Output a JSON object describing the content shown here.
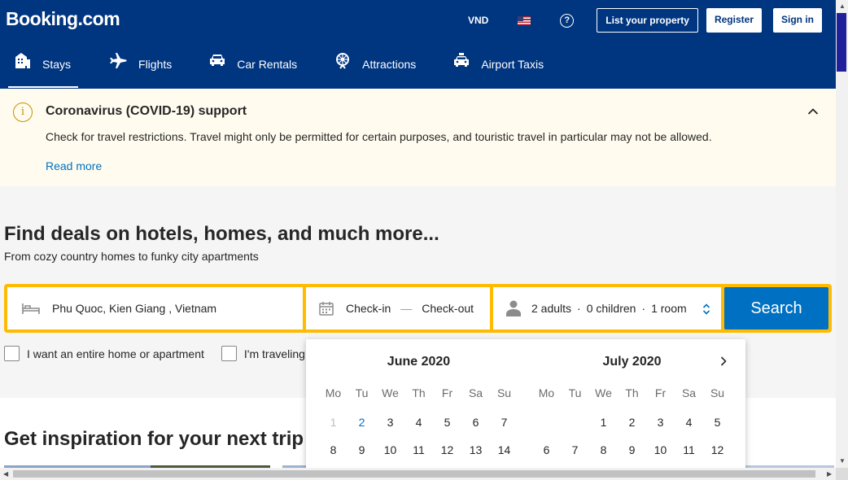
{
  "header": {
    "logo": "Booking",
    "logo_suffix": ".com",
    "currency": "VND",
    "help": "?",
    "list_property": "List your property",
    "register": "Register",
    "sign_in": "Sign in"
  },
  "nav": {
    "items": [
      {
        "label": "Stays",
        "icon": "bed-building-icon",
        "active": true
      },
      {
        "label": "Flights",
        "icon": "plane-icon",
        "active": false
      },
      {
        "label": "Car Rentals",
        "icon": "car-icon",
        "active": false
      },
      {
        "label": "Attractions",
        "icon": "ferris-wheel-icon",
        "active": false
      },
      {
        "label": "Airport Taxis",
        "icon": "taxi-icon",
        "active": false
      }
    ]
  },
  "covid": {
    "icon_glyph": "i",
    "title": "Coronavirus (COVID-19) support",
    "text": "Check for travel restrictions. Travel might only be permitted for certain purposes, and touristic travel in particular may not be allowed.",
    "link": "Read more"
  },
  "hero": {
    "title": "Find deals on hotels, homes, and much more...",
    "subtitle": "From cozy country homes to funky city apartments"
  },
  "search": {
    "destination": "Phu Quoc, Kien Giang , Vietnam",
    "check_in": "Check-in",
    "dash": "—",
    "check_out": "Check-out",
    "adults": "2 adults",
    "dot": "·",
    "children": "0 children",
    "rooms": "1 room",
    "button": "Search"
  },
  "options": {
    "entire_home": "I want an entire home or apartment",
    "traveling": "I'm traveling"
  },
  "inspiration": {
    "title": "Get inspiration for your next trip"
  },
  "calendar": {
    "weekdays": [
      "Mo",
      "Tu",
      "We",
      "Th",
      "Fr",
      "Sa",
      "Su"
    ],
    "months": [
      {
        "title": "June 2020",
        "rows": [
          [
            "1",
            "2",
            "3",
            "4",
            "5",
            "6",
            "7"
          ],
          [
            "8",
            "9",
            "10",
            "11",
            "12",
            "13",
            "14"
          ]
        ]
      },
      {
        "title": "July 2020",
        "rows": [
          [
            "",
            "",
            "1",
            "2",
            "3",
            "4",
            "5"
          ],
          [
            "6",
            "7",
            "8",
            "9",
            "10",
            "11",
            "12"
          ]
        ]
      }
    ]
  },
  "colors": {
    "brand_blue": "#003580",
    "search_yellow": "#febb02",
    "action_blue": "#0071c2"
  }
}
